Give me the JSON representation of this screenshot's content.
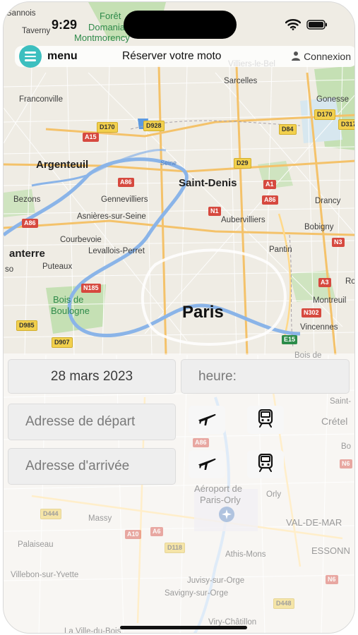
{
  "status_bar": {
    "time": "9:29"
  },
  "header": {
    "menu_label": "menu",
    "title": "Réserver votre moto",
    "login_label": "Connexion"
  },
  "form": {
    "date_value": "28 mars 2023",
    "time_placeholder": "heure:",
    "departure_placeholder": "Adresse de départ",
    "arrival_placeholder": "Adresse d'arrivée"
  },
  "map": {
    "labels": {
      "sannois": "Sannois",
      "taverny": "Taverny",
      "foret_line1": "Forêt",
      "foret_line2": "Domaniale",
      "foret_line3": "Montmorency",
      "villiers": "Villiers-le-Bel",
      "sarcelles": "Sarcelles",
      "franconville": "Franconville",
      "gonesse": "Gonesse",
      "argenteuil": "Argenteuil",
      "saint_denis": "Saint-Denis",
      "bezons": "Bezons",
      "gennevilliers": "Gennevilliers",
      "asnieres": "Asnières-sur-Seine",
      "aubervilliers": "Aubervilliers",
      "drancy": "Drancy",
      "bobigny": "Bobigny",
      "courbevoie": "Courbevoie",
      "nanterre": "anterre",
      "levallois": "Levallois-Perret",
      "pantin": "Pantin",
      "puteaux": "Puteaux",
      "suresnes": "so",
      "bois_boulogne_1": "Bois de",
      "bois_boulogne_2": "Boulogne",
      "paris": "Paris",
      "montreuil": "Montreuil",
      "vincennes": "Vincennes",
      "rosny": "Ro",
      "seine": "Seine",
      "bois_de": "Bois de",
      "saint": "Saint-",
      "creteil": "Crétel",
      "bo": "Bo",
      "aeroport_1": "Aéroport de",
      "aeroport_2": "Paris-Orly",
      "orly": "Orly",
      "massy": "Massy",
      "val_de_marne": "VAL-DE-MAR",
      "palaiseau": "Palaiseau",
      "athis_mons": "Athis-Mons",
      "essonne": "ESSONN",
      "villebon": "Villebon-sur-Yvette",
      "juvisy": "Juvisy-sur-Orge",
      "savigny": "Savigny-sur-Orge",
      "viry": "Viry-Châtillon",
      "la_ville": "La Ville-du-Bois"
    },
    "shields": {
      "d170a": "D170",
      "d928": "D928",
      "a15": "A15",
      "d84": "D84",
      "d170b": "D170",
      "d317": "D317",
      "d29": "D29",
      "a1a": "A1",
      "a86a": "A86",
      "a86b": "A86",
      "a86c": "A86",
      "n1": "N1",
      "n3": "N3",
      "a3": "A3",
      "n185": "N185",
      "n302": "N302",
      "d985": "D985",
      "d907": "D907",
      "e15": "E15",
      "a86d": "A86",
      "n6a": "N6",
      "d444": "D444",
      "a10": "A10",
      "a6": "A6",
      "d118": "D118",
      "n6b": "N6",
      "d448": "D448"
    }
  },
  "colors": {
    "accent": "#3dbfbf",
    "river": "#8ab4e8",
    "park": "#c5e0b4",
    "road_major": "#f4c26a",
    "road_minor": "#ffffff"
  }
}
